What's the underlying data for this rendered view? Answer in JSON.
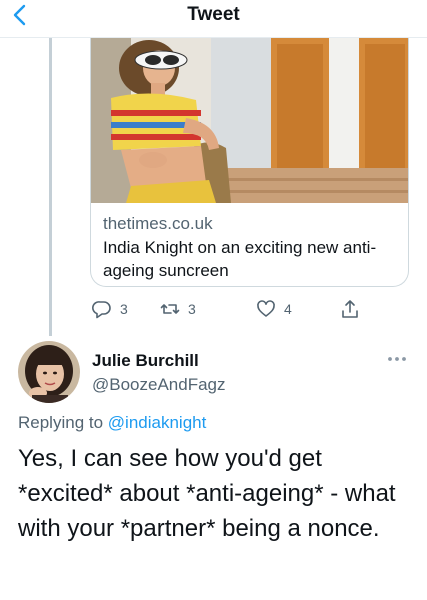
{
  "header": {
    "title": "Tweet",
    "back_icon": "chevron-left-icon",
    "accent": "#1d9bf0"
  },
  "link_card": {
    "domain": "thetimes.co.uk",
    "title": "India Knight on an exciting new anti-ageing suncreen"
  },
  "actions": {
    "reply_count": "3",
    "retweet_count": "3",
    "like_count": "4",
    "icons": [
      "reply-icon",
      "retweet-icon",
      "like-icon",
      "share-icon"
    ]
  },
  "reply": {
    "display_name": "Julie Burchill",
    "handle": "@BoozeAndFagz",
    "replying_prefix": "Replying to",
    "replying_to": "@indiaknight",
    "text": "Yes, I can see how you'd get *excited* about *anti-ageing* - what with your *partner* being a nonce."
  }
}
